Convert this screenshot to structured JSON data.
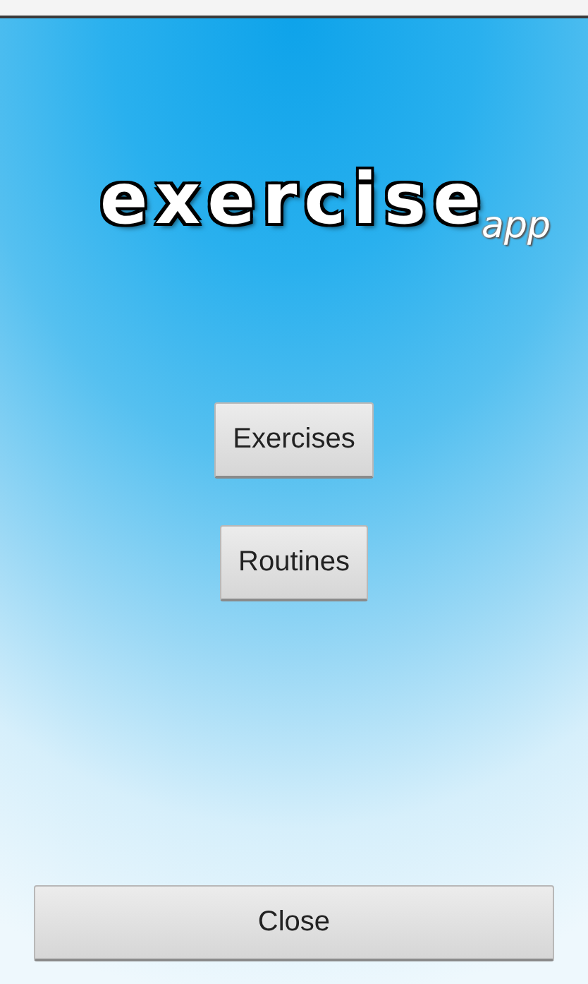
{
  "logo": {
    "title": "exercise",
    "subtitle": "app"
  },
  "menu_buttons": [
    {
      "label": "Exercises"
    },
    {
      "label": "Routines"
    }
  ],
  "close_button": {
    "label": "Close"
  }
}
